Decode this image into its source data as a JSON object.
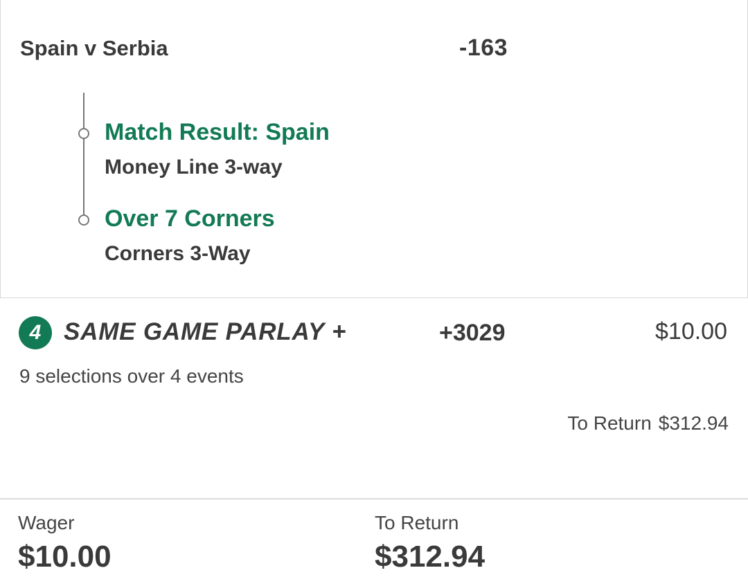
{
  "event": {
    "title": "Spain v Serbia",
    "odds": "-163",
    "selections": [
      {
        "title": "Match Result: Spain",
        "market": "Money Line 3-way"
      },
      {
        "title": "Over 7 Corners",
        "market": "Corners 3-Way"
      }
    ]
  },
  "parlay": {
    "badge": "4",
    "title": "SAME GAME PARLAY +",
    "odds": "+3029",
    "stake": "$10.00",
    "subtitle": "9 selections over 4 events",
    "return_label": "To Return",
    "return_value": "$312.94"
  },
  "summary": {
    "wager_label": "Wager",
    "wager_value": "$10.00",
    "return_label": "To Return",
    "return_value": "$312.94"
  },
  "colors": {
    "accent": "#127a55",
    "text": "#3a3a3a"
  }
}
